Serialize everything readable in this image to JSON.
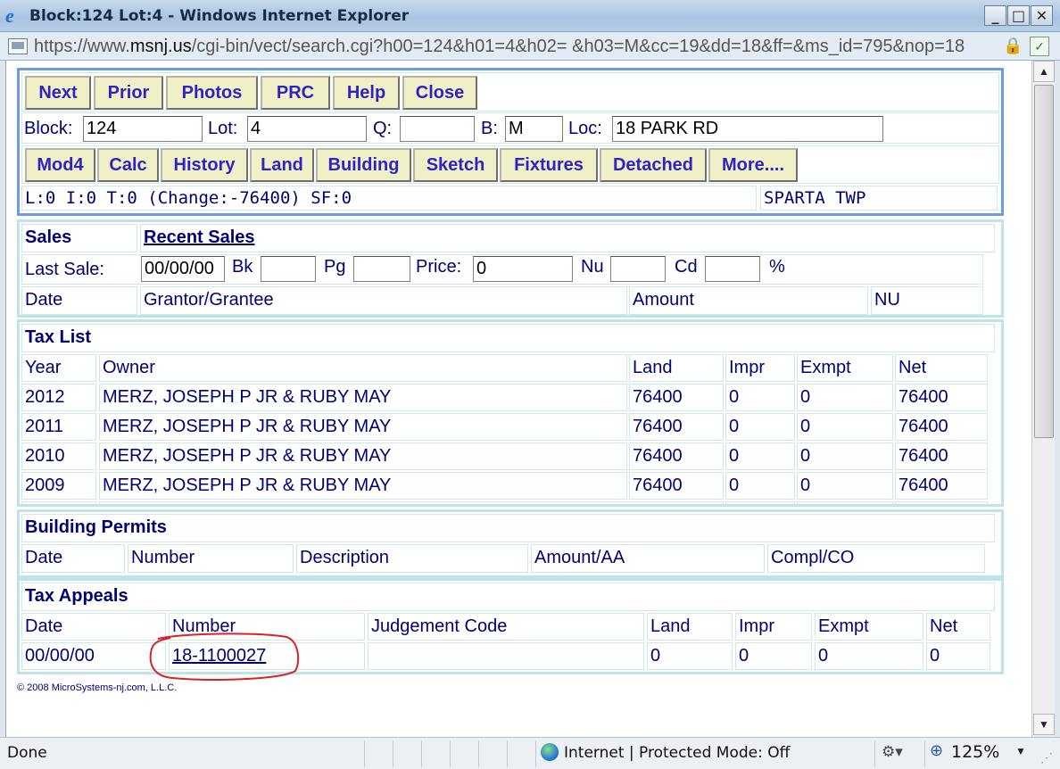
{
  "window": {
    "title": "Block:124 Lot:4 - Windows Internet Explorer",
    "minimize": "_",
    "maximize": "□",
    "close": "✕"
  },
  "address": {
    "prefix": "https://www.",
    "domain": "msnj.us",
    "path": "/cgi-bin/vect/search.cgi?h00=124&h01=4&h02= &h03=M&cc=19&dd=18&ff=&ms_id=795&nop=18"
  },
  "nav": {
    "buttons": [
      "Next",
      "Prior",
      "Photos",
      "PRC",
      "Help",
      "Close"
    ],
    "tabs": [
      "Mod4",
      "Calc",
      "History",
      "Land",
      "Building",
      "Sketch",
      "Fixtures",
      "Detached",
      "More...."
    ]
  },
  "property": {
    "block_label": "Block:",
    "block_value": "124",
    "lot_label": "Lot:",
    "lot_value": "4",
    "q_label": "Q:",
    "q_value": "",
    "b_label": "B:",
    "b_value": "M",
    "loc_label": "Loc:",
    "loc_value": "18 PARK RD",
    "summary": "L:0 I:0 T:0 (Change:-76400) SF:0",
    "municipality": "SPARTA TWP"
  },
  "sales": {
    "title": "Sales",
    "recent_link": "Recent Sales",
    "last_sale_label": "Last Sale:",
    "last_sale_value": "00/00/00",
    "bk_label": "Bk",
    "bk_value": "",
    "pg_label": "Pg",
    "pg_value": "",
    "price_label": "Price:",
    "price_value": "0",
    "nu_label": "Nu",
    "nu_value": "",
    "cd_label": "Cd",
    "cd_value": "",
    "pct": "%",
    "columns": [
      "Date",
      "Grantor/Grantee",
      "Amount",
      "NU"
    ]
  },
  "tax_list": {
    "title": "Tax List",
    "columns": [
      "Year",
      "Owner",
      "Land",
      "Impr",
      "Exmpt",
      "Net"
    ],
    "rows": [
      [
        "2012",
        "MERZ, JOSEPH P JR & RUBY MAY",
        "76400",
        "0",
        "0",
        "76400"
      ],
      [
        "2011",
        "MERZ, JOSEPH P JR & RUBY MAY",
        "76400",
        "0",
        "0",
        "76400"
      ],
      [
        "2010",
        "MERZ, JOSEPH P JR & RUBY MAY",
        "76400",
        "0",
        "0",
        "76400"
      ],
      [
        "2009",
        "MERZ, JOSEPH P JR & RUBY MAY",
        "76400",
        "0",
        "0",
        "76400"
      ]
    ]
  },
  "permits": {
    "title": "Building Permits",
    "columns": [
      "Date",
      "Number",
      "Description",
      "Amount/AA",
      "Compl/CO"
    ]
  },
  "appeals": {
    "title": "Tax Appeals",
    "columns": [
      "Date",
      "Number",
      "Judgement Code",
      "Land",
      "Impr",
      "Exmpt",
      "Net"
    ],
    "row": [
      "00/00/00",
      "18-1100027",
      "",
      "0",
      "0",
      "0",
      "0"
    ],
    "highlight_color": "#d9232a"
  },
  "footer": {
    "copyright": "© 2008 MicroSystems-nj.com, L.L.C."
  },
  "status": {
    "text": "Done",
    "zone": "Internet | Protected Mode: Off",
    "zoom": "125%"
  }
}
